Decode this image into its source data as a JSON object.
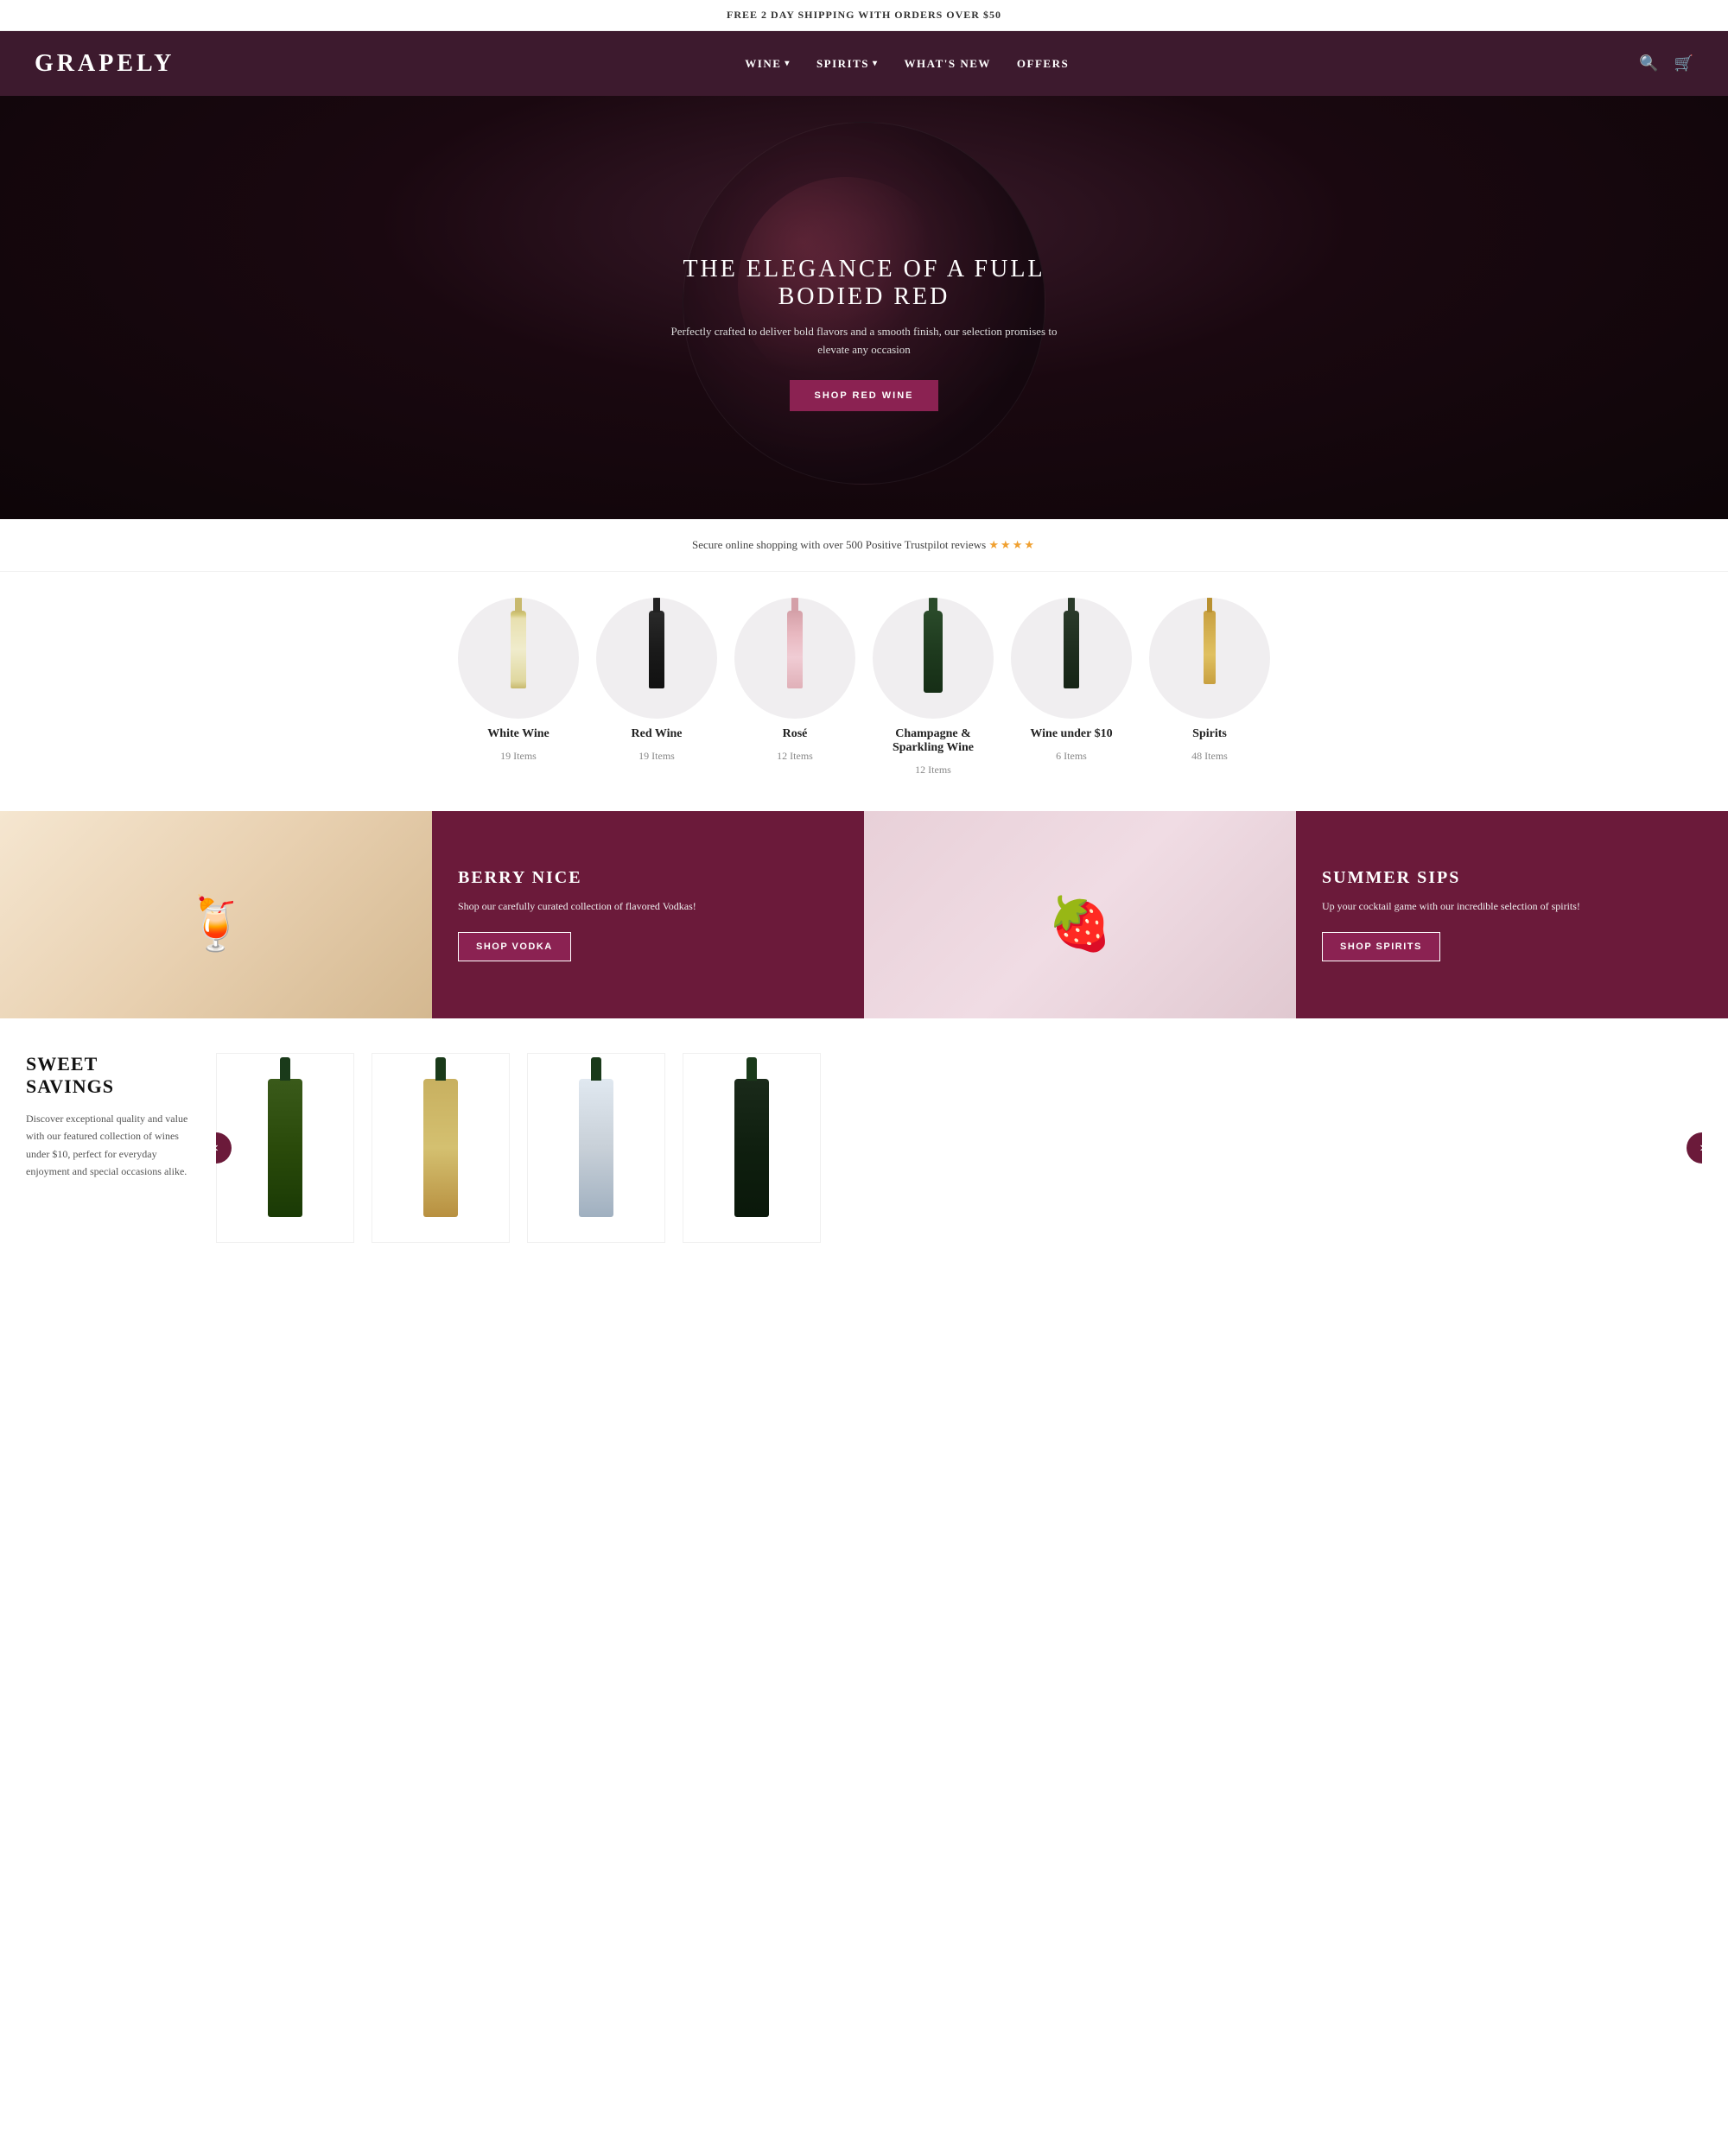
{
  "top_banner": {
    "text": "FREE 2 DAY SHIPPING WITH ORDERS OVER $50"
  },
  "header": {
    "logo": "GRAPELY",
    "nav_items": [
      {
        "label": "WINE",
        "has_dropdown": true
      },
      {
        "label": "SPIRITS",
        "has_dropdown": true
      },
      {
        "label": "WHAT'S NEW",
        "has_dropdown": false
      },
      {
        "label": "OFFERS",
        "has_dropdown": false
      }
    ]
  },
  "hero": {
    "title": "THE ELEGANCE OF A FULL BODIED RED",
    "subtitle": "Perfectly crafted to deliver bold flavors and a smooth finish, our selection promises to elevate any occasion",
    "cta_label": "SHOP RED WINE"
  },
  "trust_bar": {
    "text": "Secure online shopping with over 500 Positive Trustpilot reviews",
    "stars": "★★★★"
  },
  "categories": [
    {
      "name": "White Wine",
      "count": "19 Items",
      "bottle_type": "white"
    },
    {
      "name": "Red Wine",
      "count": "19 Items",
      "bottle_type": "red"
    },
    {
      "name": "Rosé",
      "count": "12 Items",
      "bottle_type": "rose"
    },
    {
      "name": "Champagne & Sparkling Wine",
      "count": "12 Items",
      "bottle_type": "champ"
    },
    {
      "name": "Wine under $10",
      "count": "6 Items",
      "bottle_type": "under10"
    },
    {
      "name": "Spirits",
      "count": "48 Items",
      "bottle_type": "spirits"
    }
  ],
  "promo_blocks": [
    {
      "title": "BERRY NICE",
      "desc": "Shop our carefully curated collection of flavored Vodkas!",
      "cta_label": "SHOP VODKA",
      "image_emoji": "🍹"
    },
    {
      "title": "SUMMER SIPS",
      "desc": "Up your cocktail game with our incredible selection of spirits!",
      "cta_label": "SHOP SPIRITS",
      "image_emoji": "🍓"
    }
  ],
  "sweet_savings": {
    "title": "SWEET SAVINGS",
    "desc": "Discover exceptional quality and value with our featured collection of wines under $10, perfect for everyday enjoyment and special occasions alike.",
    "carousel_nav_prev": "‹",
    "carousel_nav_next": "›"
  }
}
